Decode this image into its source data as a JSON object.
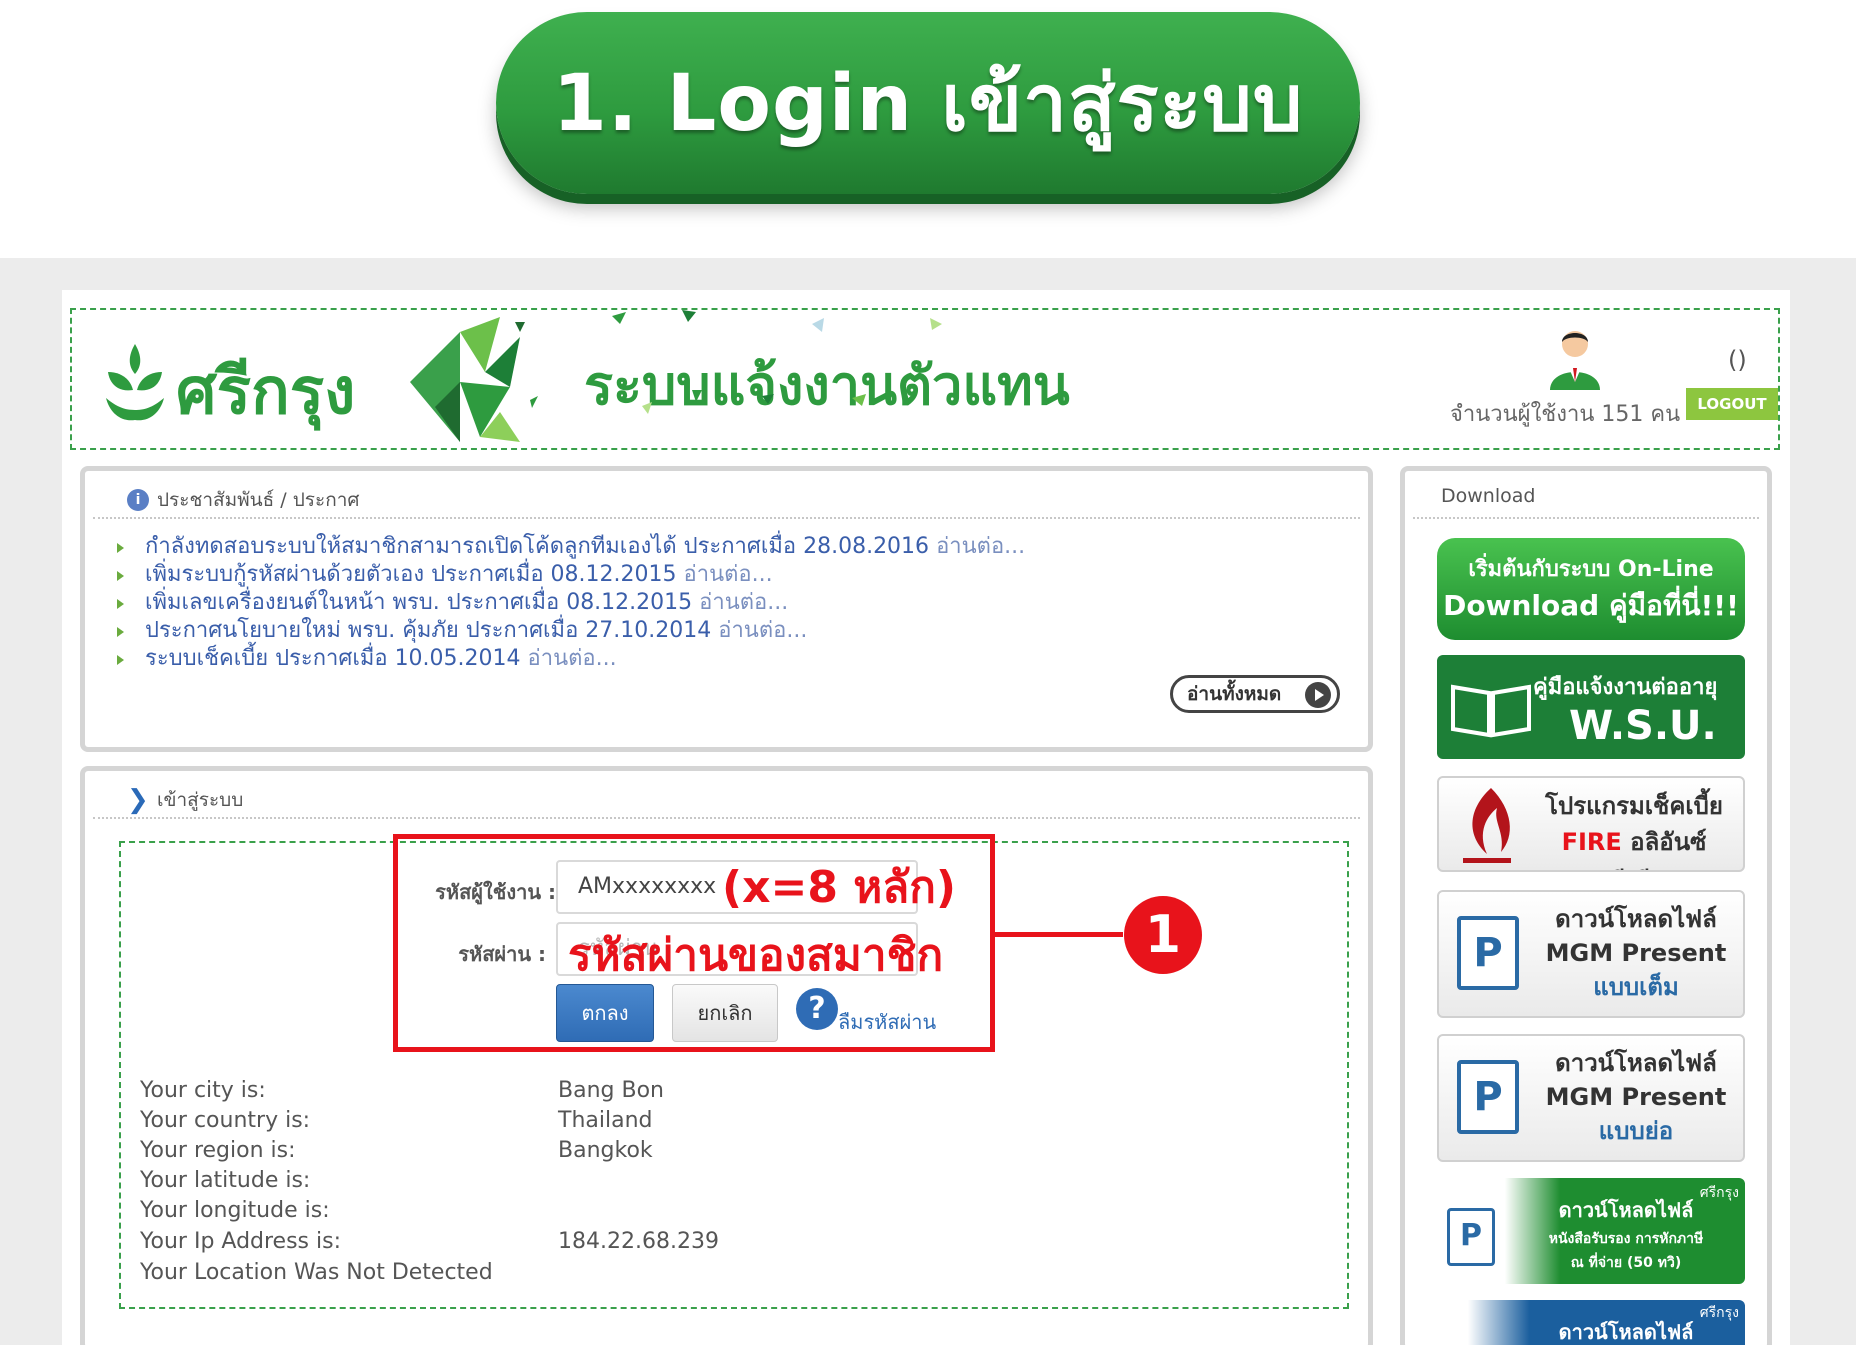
{
  "banner": {
    "label": "1. Login เข้าสู่ระบบ"
  },
  "header": {
    "brand": "ศรีกรุง",
    "system_title": "ระบบแจ้งงานตัวแทน",
    "user_paren": "()",
    "user_count": "จำนวนผู้ใช้งาน 151 คน",
    "logout_label": "LOGOUT"
  },
  "news": {
    "title": "ประชาสัมพันธ์ / ประกาศ",
    "items": [
      {
        "text": "กำลังทดสอบระบบให้สมาชิกสามารถเปิดโค้ดลูกทีมเองได้ ประกาศเมื่อ 28.08.2016",
        "more": "อ่านต่อ..."
      },
      {
        "text": "เพิ่มระบบกู้รหัสผ่านด้วยตัวเอง ประกาศเมื่อ 08.12.2015",
        "more": "อ่านต่อ..."
      },
      {
        "text": "เพิ่มเลขเครื่องยนต์ในหน้า พรบ. ประกาศเมื่อ 08.12.2015",
        "more": "อ่านต่อ..."
      },
      {
        "text": "ประกาศนโยบายใหม่ พรบ. คุ้มภัย ประกาศเมื่อ 27.10.2014",
        "more": "อ่านต่อ..."
      },
      {
        "text": "ระบบเช็คเบี้ย ประกาศเมื่อ 10.05.2014",
        "more": "อ่านต่อ..."
      }
    ],
    "read_all_label": "อ่านทั้งหมด"
  },
  "login": {
    "title": "เข้าสู่ระบบ",
    "username_label": "รหัสผู้ใช้งาน :",
    "username_value": "AMxxxxxxxx",
    "password_label": "รหัสผ่าน :",
    "password_placeholder": "รหัสผ่าน",
    "ok_label": "ตกลง",
    "cancel_label": "ยกเลิก",
    "help_icon": "?",
    "forgot_label": "ลืมรหัสผ่าน"
  },
  "geo": {
    "rows": [
      {
        "label": "Your city is:",
        "value": "Bang Bon"
      },
      {
        "label": "Your country is:",
        "value": "Thailand"
      },
      {
        "label": "Your region is:",
        "value": "Bangkok"
      },
      {
        "label": "Your latitude is:",
        "value": ""
      },
      {
        "label": "Your longitude is:",
        "value": ""
      },
      {
        "label": "Your Ip Address is:",
        "value": "184.22.68.239"
      },
      {
        "label": "Your Location Was Not Detected",
        "value": ""
      }
    ]
  },
  "annotation": {
    "digits_note": "(x=8 หลัก)",
    "password_note": "รหัสผ่านของสมาชิก",
    "step_number": "1"
  },
  "download": {
    "title": "Download",
    "online_line1": "เริ่มต้นกับระบบ On-Line",
    "online_line2": "Download คู่มือที่นี่!!!",
    "wsu_line1": "คู่มือแจ้งงานต่ออายุ",
    "wsu_line2": "W.S.U.",
    "check_line1": "โปรแกรมเช็คเบี้ย",
    "check_fire": "FIRE",
    "check_line2": "อลิอันซ์ ซี.พี.",
    "mgm_full_line1": "ดาวน์โหลดไฟล์",
    "mgm_full_line2": "MGM Present",
    "mgm_full_line3": "แบบเต็ม",
    "mgm_short_line1": "ดาวน์โหลดไฟล์",
    "mgm_short_line2": "MGM Present",
    "mgm_short_line3": "แบบย่อ",
    "tax_line1": "ดาวน์โหลดไฟล์",
    "tax_line2": "หนังสือรับรอง การหักภาษี",
    "tax_line3": "ณ ที่จ่าย (50 ทวิ)",
    "tax_brand": "ศรีกรุง",
    "last_line1": "ดาวน์โหลดไฟล์",
    "last_brand": "ศรีกรุง",
    "pdf_letter": "P"
  },
  "colors": {
    "brand_green": "#2e9b3f",
    "annotation_red": "#e8131b",
    "link_blue": "#3a5eaa",
    "button_blue": "#2f6cb5"
  }
}
